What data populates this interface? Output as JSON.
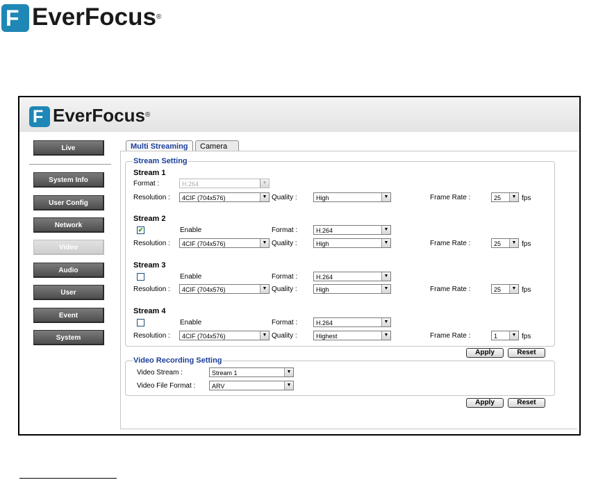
{
  "doc_logo": {
    "mark": "F",
    "text": "EverFocus",
    "reg": "®"
  },
  "app_logo": {
    "mark": "F",
    "text": "EverFocus",
    "reg": "®"
  },
  "sidebar": {
    "items": [
      {
        "label": "Live"
      },
      {
        "label": "System Info"
      },
      {
        "label": "User Config"
      },
      {
        "label": "Network"
      },
      {
        "label": "Video",
        "active": true
      },
      {
        "label": "Audio"
      },
      {
        "label": "User"
      },
      {
        "label": "Event"
      },
      {
        "label": "System"
      }
    ]
  },
  "tabs": [
    {
      "label": "Multi Streaming",
      "active": true
    },
    {
      "label": "Camera"
    }
  ],
  "stream_setting": {
    "legend": "Stream Setting",
    "format_label": "Format :",
    "resolution_label": "Resolution :",
    "quality_label": "Quality :",
    "frame_rate_label": "Frame Rate :",
    "fps_label": "fps",
    "enable_label": "Enable",
    "stream1": {
      "title": "Stream 1",
      "format": "H.264",
      "resolution": "4CIF (704x576)",
      "quality": "High",
      "frame_rate": "25"
    },
    "stream2": {
      "title": "Stream 2",
      "enabled": "✔",
      "format": "H.264",
      "resolution": "4CIF (704x576)",
      "quality": "High",
      "frame_rate": "25"
    },
    "stream3": {
      "title": "Stream 3",
      "enabled": "",
      "format": "H.264",
      "resolution": "4CIF (704x576)",
      "quality": "High",
      "frame_rate": "25"
    },
    "stream4": {
      "title": "Stream 4",
      "enabled": "",
      "format": "H.264",
      "resolution": "4CIF (704x576)",
      "quality": "Highest",
      "frame_rate": "1"
    }
  },
  "stream_buttons": {
    "apply": "Apply",
    "reset": "Reset"
  },
  "video_recording": {
    "legend": "Video Recording Setting",
    "video_stream_label": "Video Stream :",
    "video_stream": "Stream 1",
    "file_format_label": "Video File Format :",
    "file_format": "ARV"
  },
  "recording_buttons": {
    "apply": "Apply",
    "reset": "Reset"
  },
  "icons": {
    "dropdown": "chevron-down-icon",
    "check": "checkmark-icon"
  },
  "colors": {
    "brand_blue": "#1f87b5",
    "legend_blue": "#1d3f9a",
    "sidebar_gray": "#5e5e5e",
    "check_green": "#239a20"
  }
}
